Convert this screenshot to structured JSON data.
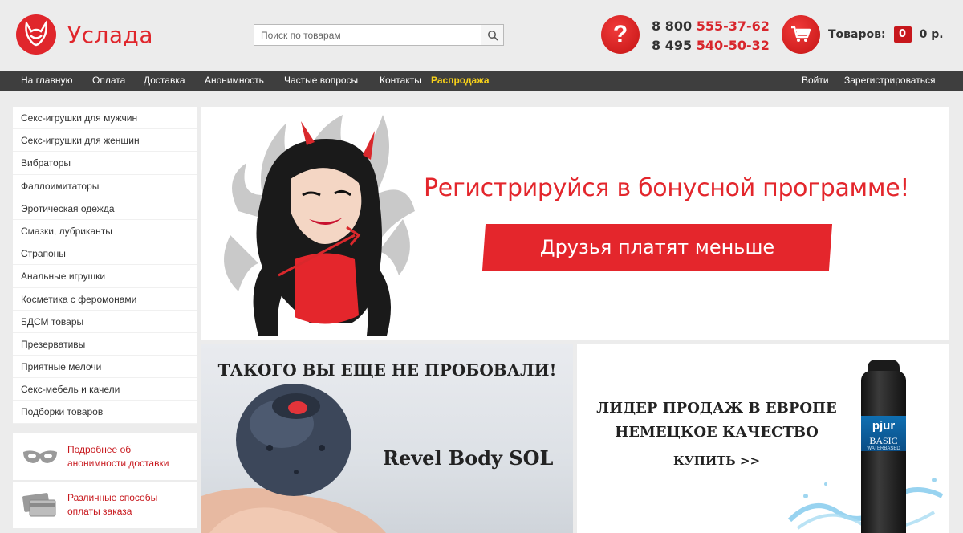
{
  "header": {
    "logo_text": "Услада",
    "search_placeholder": "Поиск по товарам",
    "phone1_prefix": "8 800",
    "phone1_number": "555-37-62",
    "phone2_prefix": "8 495",
    "phone2_number": "540-50-32",
    "cart_label": "Товаров:",
    "cart_count": "0",
    "cart_total": "0 р."
  },
  "nav": {
    "items": [
      "На главную",
      "Оплата",
      "Доставка",
      "Анонимность",
      "Частые вопросы",
      "Контакты"
    ],
    "sale": "Распродажа",
    "login": "Войти",
    "register": "Зарегистрироваться"
  },
  "sidebar": {
    "categories": [
      "Секс-игрушки для мужчин",
      "Секс-игрушки для женщин",
      "Вибраторы",
      "Фаллоимитаторы",
      "Эротическая одежда",
      "Смазки, лубриканты",
      "Страпоны",
      "Анальные игрушки",
      "Косметика с феромонами",
      "БДСМ товары",
      "Презервативы",
      "Приятные мелочи",
      "Секс-мебель и качели",
      "Подборки товаров"
    ],
    "info": [
      {
        "line1": "Подробнее об",
        "line2": "анонимности доставки",
        "icon": "mask-icon"
      },
      {
        "line1": "Различные способы",
        "line2": "оплаты заказа",
        "icon": "card-icon"
      }
    ]
  },
  "banner_main": {
    "title": "Регистрируйся в бонусной программе!",
    "subtitle": "Друзья платят меньше"
  },
  "banner_left": {
    "title": "ТАКОГО ВЫ ЕЩЕ НЕ ПРОБОВАЛИ!",
    "product": "Revel Body SOL"
  },
  "banner_right": {
    "line1": "ЛИДЕР ПРОДАЖ В ЕВРОПЕ",
    "line2": "НЕМЕЦКОЕ КАЧЕСТВО",
    "buy": "КУПИТЬ >>",
    "bottle_brand": "pjur",
    "bottle_line1": "BASIC",
    "bottle_line2": "WATERBASED"
  },
  "colors": {
    "accent": "#e0262c",
    "nav_bg": "#3e3e3e",
    "sale": "#f7d11a"
  }
}
